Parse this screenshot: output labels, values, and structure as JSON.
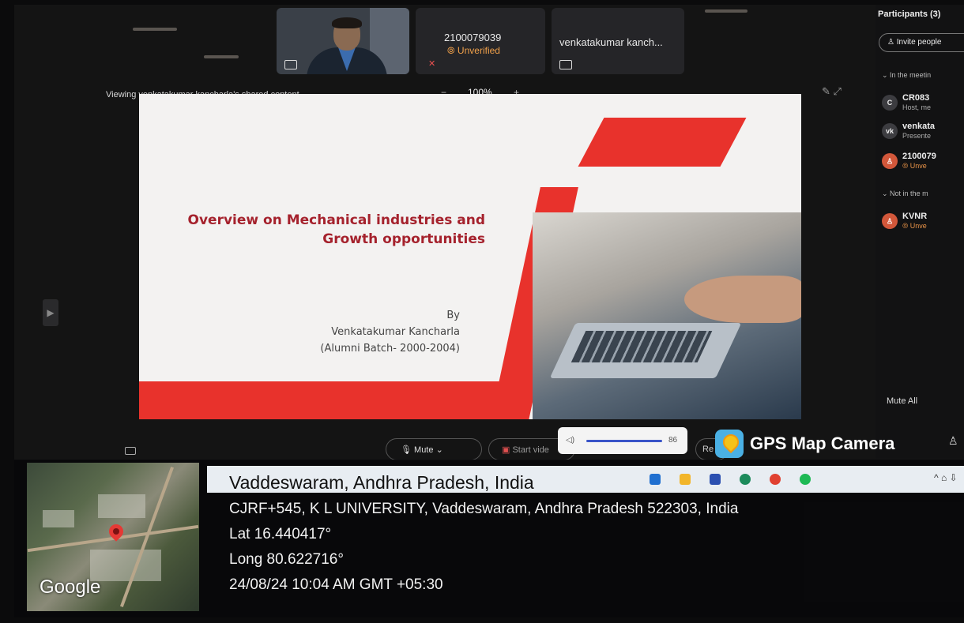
{
  "tiles": {
    "mid_name": "2100079039",
    "mid_status": "⦾ Unverified",
    "right_name": "venkatakumar kanch..."
  },
  "share": {
    "viewing": "Viewing venkatakumar kancharla's shared content",
    "zoom_minus": "−",
    "zoom": "100%",
    "zoom_plus": "+"
  },
  "slide": {
    "title_line1": "Overview on Mechanical industries and",
    "title_line2": "Growth opportunities",
    "by": "By",
    "author": "Venkatakumar Kancharla",
    "batch": "(Alumni Batch- 2000-2004)"
  },
  "participants": {
    "title": "Participants (3)",
    "invite": "Invite people",
    "in_meeting": "In the meetin",
    "not_in_meeting": "Not in the m",
    "people": [
      {
        "initials": "C",
        "name": "CR083",
        "sub": "Host, me"
      },
      {
        "initials": "vk",
        "name": "venkata",
        "sub": "Presente"
      },
      {
        "initials": "",
        "name": "2100079",
        "sub": "Unve"
      }
    ],
    "absent": [
      {
        "initials": "",
        "name": "KVNR",
        "sub": "Unve"
      }
    ],
    "mute_all": "Mute All"
  },
  "controls": {
    "mute": "Mute",
    "start_video": "Start vide",
    "volume_value": "86",
    "record": "Re"
  },
  "gps": {
    "badge": "GPS Map Camera",
    "map_label": "Google",
    "place": "Vaddeswaram, Andhra Pradesh, India",
    "address": "CJRF+545, K L UNIVERSITY, Vaddeswaram, Andhra Pradesh 522303, India",
    "lat": "Lat 16.440417°",
    "long": "Long 80.622716°",
    "datetime": "24/08/24 10:04 AM GMT +05:30"
  },
  "colors": {
    "slide_red": "#e8322c",
    "title_red": "#a5222d",
    "unverified": "#f0a04a",
    "volume_blue": "#3a55c8"
  }
}
